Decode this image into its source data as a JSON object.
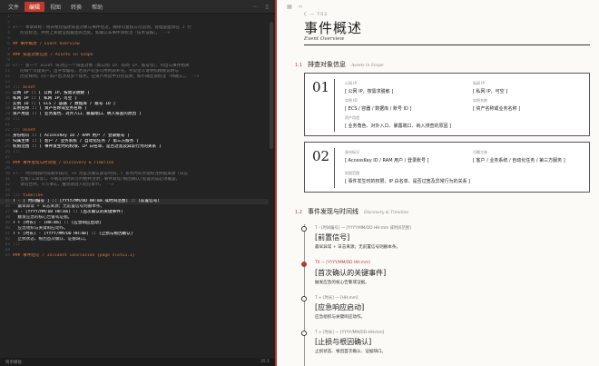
{
  "menu": {
    "items": [
      {
        "label": "文件",
        "active": false
      },
      {
        "label": "编辑",
        "active": true
      },
      {
        "label": "视图",
        "active": false
      },
      {
        "label": "转换",
        "active": false
      },
      {
        "label": "帮助",
        "active": false
      }
    ]
  },
  "editor": {
    "lines": [
      {
        "n": "1",
        "t": "---",
        "c": "t-dim"
      },
      {
        "n": "2",
        "t": "",
        "c": "t-text"
      },
      {
        "n": "3",
        "t": "<!-- 本章目标：用表格化描述排查对象与事件经过，确保可复核与可追溯。管理层面请在 1 行",
        "c": "t-comment"
      },
      {
        "n": "4",
        "t": "   阶段标注，并附上关键证据截图的出处。如确认非事件请标注「技术误报」。 -->",
        "c": "t-comment"
      },
      {
        "n": "5",
        "t": "",
        "c": "t-text"
      },
      {
        "n": "6",
        "t": "## 事件概述 / Event Overview",
        "c": "t-head"
      },
      {
        "n": "7",
        "t": "",
        "c": "t-text"
      },
      {
        "n": "8",
        "t": "### 排查对象信息 / Assets in Scope",
        "c": "t-head"
      },
      {
        "n": "9",
        "t": "",
        "c": "t-text"
      },
      {
        "n": "10",
        "t": "<!-- 第一个 asset 块对应一个排查对象（如公网 IP、私网 IP、账号等），列出与事件相关",
        "c": "t-comment"
      },
      {
        "n": "11",
        "t": "   的每个可疑资产。首字母编号，若资产较多可用附表补充。字段含义请参照模板说明与",
        "c": "t-comment"
      },
      {
        "n": "12",
        "t": "   历史样例；同一资产若涉及多个角色，在资产用途中分别说明；如不确定请标注「待确认」。 -->",
        "c": "t-comment"
      },
      {
        "n": "13",
        "t": "",
        "c": "t-text"
      },
      {
        "n": "14",
        "t": "::: asset",
        "c": "t-accent"
      },
      {
        "n": "15",
        "t": "公网 IP :: [ 公网 IP，按需求脱敏 ]",
        "c": "t-bold"
      },
      {
        "n": "16",
        "t": "私网 IP :: [ 私网 IP，可空 ]",
        "c": "t-bold"
      },
      {
        "n": "17",
        "t": "实例 ID :: [ ECS / 容器 / 数据库 / 账号 ID ]",
        "c": "t-bold"
      },
      {
        "n": "18",
        "t": "实例名称 :: [ 资产名称或业务名称 ]",
        "c": "t-bold"
      },
      {
        "n": "19",
        "t": "资产用途 :: [ 业务角色、对外入口、暴露端口、纳入排查的原因 ]",
        "c": "t-bold"
      },
      {
        "n": "20",
        "t": ":::",
        "c": "t-accent"
      },
      {
        "n": "21",
        "t": "",
        "c": "t-text"
      },
      {
        "n": "22",
        "t": "::: asset",
        "c": "t-accent"
      },
      {
        "n": "23",
        "t": "身份标识 :: [ AccessKey ID / RAM 用户 / 登录账号 ]",
        "c": "t-bold"
      },
      {
        "n": "24",
        "t": "归属主体 :: [ 客户 / 业务系统 / 自动化任务 / 第三方服务 ]",
        "c": "t-bold"
      },
      {
        "n": "25",
        "t": "权限范围 :: [ 事件发生时的权限、IP 白名单、是否过宽及异常行为的关系 ]",
        "c": "t-bold"
      },
      {
        "n": "26",
        "t": ":::",
        "c": "t-accent"
      },
      {
        "n": "27",
        "t": "",
        "c": "t-text"
      },
      {
        "n": "28",
        "t": "### 事件发现与时间线 / Discovery & Timeline",
        "c": "t-head"
      },
      {
        "n": "29",
        "t": "",
        "c": "t-text"
      },
      {
        "n": "30",
        "t": "<!-- 时间线按时间顺序排列；T0 为首次确认异常时刻，T 系列时间点需标注依据来源（日志",
        "c": "t-comment"
      },
      {
        "n": "31",
        "t": "   告警/工单等）。不确定的时间写约数并注明；事件发现/根因确认/处置完成必须覆盖，",
        "c": "t-comment"
      },
      {
        "n": "32",
        "t": "   请勿合并。只写事实，推测请放入结论章节。 -->",
        "c": "t-comment"
      },
      {
        "n": "33",
        "t": "",
        "c": "t-text"
      },
      {
        "n": "34",
        "t": "::: timeline",
        "c": "t-accent"
      },
      {
        "n": "35",
        "t": "T - [ 时间编号 ] :: [YYYY/MM/DD HH:mm 或时间范围] :: [前置信号]",
        "c": "t-bold"
      },
      {
        "n": "36",
        "t": "  最早异常 + 日志来源；无前置信号则删本条。",
        "c": "t-text"
      },
      {
        "n": "37",
        "t": "T0 - [YYYY/MM/DD HH:mm] :: [首次确认的关键事件]",
        "c": "t-bold"
      },
      {
        "n": "38",
        "t": "  触发应急的核心告警或证据。",
        "c": "t-text"
      },
      {
        "n": "39",
        "t": "T + [时长] - [HH:mm] :: [应急响应启动]",
        "c": "t-bold"
      },
      {
        "n": "40",
        "t": "  应急组织与关键响应动作。",
        "c": "t-text"
      },
      {
        "n": "41",
        "t": "T + [时长] - [YYYY/MM/DD HH:mm] :: [止损与根因确认]",
        "c": "t-bold"
      },
      {
        "n": "42",
        "t": "  止损状态、根因首次确认、证据缺口。",
        "c": "t-text"
      },
      {
        "n": "43",
        "t": ":::",
        "c": "t-accent"
      },
      {
        "n": "44",
        "t": "",
        "c": "t-text"
      },
      {
        "n": "45",
        "t": "### 事件结论 / Incident Conclusion {page slot=1.1}",
        "c": "t-head"
      }
    ],
    "highlight_line": "35"
  },
  "status": {
    "left": "简单模板",
    "right": "35:1"
  },
  "preview": {
    "chapter_small": "C — T03",
    "title": "事件概述",
    "subtitle": "Event Overview",
    "sec1": {
      "num": "1.1",
      "label": "排查对象信息",
      "en": "Assets in Scope"
    },
    "card1": {
      "num": "01",
      "f1k": "公网 IP",
      "f1v": "[ 公网 IP，按需求脱敏 ]",
      "f2k": "私网 IP",
      "f2v": "[ 私网 IP，可空 ]",
      "f3k": "实例 ID",
      "f3v": "[ ECS / 容器 / 数据库 / 账号 ID ]",
      "f4k": "实例名称",
      "f4v": "[ 资产名称或业务名称 ]",
      "f5k": "资产用途",
      "f5v": "[ 业务角色、对外入口、暴露端口、纳入排查的原因 ]"
    },
    "card2": {
      "num": "02",
      "f1k": "身份标识",
      "f1v": "[ AccessKey ID / RAM 用户 / 登录账号 ]",
      "f2k": "归属主体",
      "f2v": "[ 客户 / 业务系统 / 自动化任务 / 第三方服务 ]",
      "f3k": "权限范围",
      "f3v": "[ 事件发生时的权限、IP 白名单、是否过宽及异常行为的关系 ]"
    },
    "sec2": {
      "num": "1.2",
      "label": "事件发现与时间线",
      "en": "Discovery & Timeline"
    },
    "timeline": [
      {
        "ts": "T - [时间编号] — [YYYY/MM/DD HH:mm 或时间范围]",
        "h": "[前置信号]",
        "d": "最早异常 + 日志来源；无前置信号则删本条。",
        "key": false
      },
      {
        "ts": "T0 — [YYYY/MM/DD HH:mm]",
        "h": "[首次确认的关键事件]",
        "d": "触发应急的核心告警或证据。",
        "key": true
      },
      {
        "ts": "T + [时长] — [HH:mm]",
        "h": "[应急响应启动]",
        "d": "应急组织与关键响应动作。",
        "key": false
      },
      {
        "ts": "T + [时长] — [YYYY/MM/DD HH:mm]",
        "h": "[止损与根因确认]",
        "d": "止损状态、根因首次确认、证据缺口。",
        "key": false
      }
    ]
  },
  "colors": {
    "accent": "#b13b30",
    "menu_active": "#c0392b",
    "editor_bg": "#232323",
    "paper_bg": "#fbfaf7"
  },
  "icons": [
    "chevron-down-icon",
    "more-icon",
    "sidebar-icon",
    "panel-icon",
    "code-icon",
    "eye-icon"
  ]
}
